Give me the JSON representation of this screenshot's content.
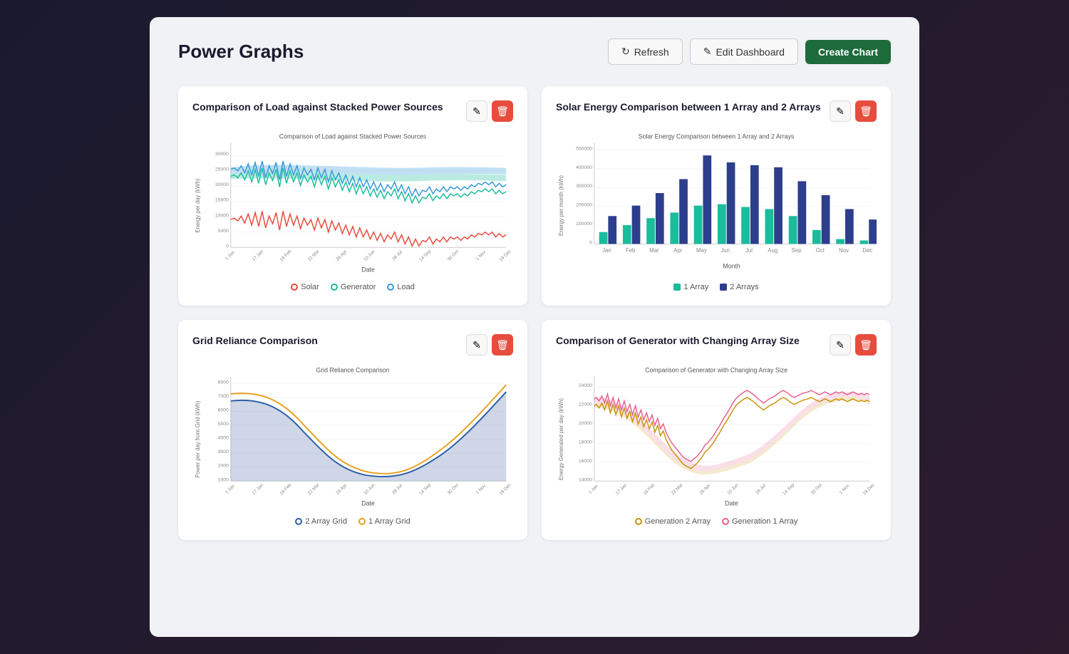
{
  "header": {
    "title": "Power Graphs",
    "refresh_label": "Refresh",
    "edit_label": "Edit Dashboard",
    "create_label": "Create Chart"
  },
  "charts": [
    {
      "id": "chart1",
      "title": "Comparison of Load against Stacked Power Sources",
      "subtitle": "Comparison of Load against Stacked Power Sources",
      "legend": [
        {
          "label": "Solar",
          "color": "#e74c3c",
          "type": "line"
        },
        {
          "label": "Generator",
          "color": "#1abc9c",
          "type": "line"
        },
        {
          "label": "Load",
          "color": "#3498db",
          "type": "line"
        }
      ]
    },
    {
      "id": "chart2",
      "title": "Solar Energy Comparison between 1 Array and 2 Arrays",
      "subtitle": "Solar Energy Comparison between 1 Array and 2 Arrays",
      "legend": [
        {
          "label": "1 Array",
          "color": "#1abc9c",
          "type": "square"
        },
        {
          "label": "2 Arrays",
          "color": "#2c3e8c",
          "type": "square"
        }
      ]
    },
    {
      "id": "chart3",
      "title": "Grid Reliance Comparison",
      "subtitle": "Grid Reliance Comparison",
      "legend": [
        {
          "label": "2 Array Grid",
          "color": "#2c5fa8",
          "type": "line"
        },
        {
          "label": "1 Array Grid",
          "color": "#e8a020",
          "type": "line"
        }
      ]
    },
    {
      "id": "chart4",
      "title": "Comparison of Generator with Changing Array Size",
      "subtitle": "Comparison of Generator with Changing Array Size",
      "legend": [
        {
          "label": "Generation 2 Array",
          "color": "#c8920a",
          "type": "line"
        },
        {
          "label": "Generation 1 Array",
          "color": "#e86090",
          "type": "line"
        }
      ]
    }
  ]
}
